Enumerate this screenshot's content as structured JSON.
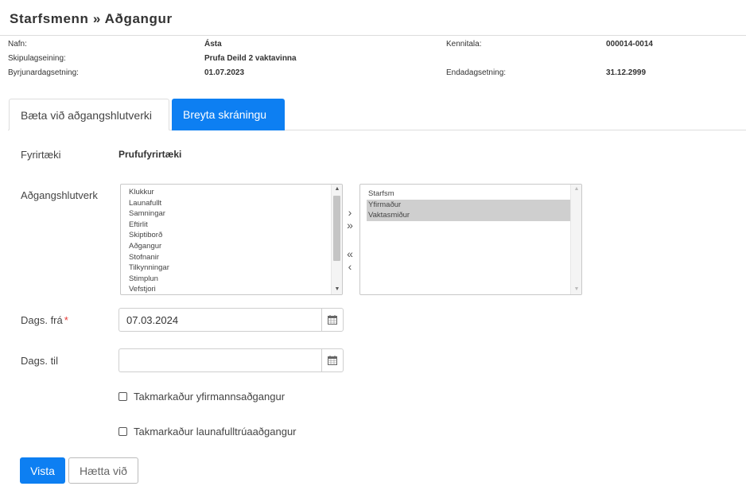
{
  "page": {
    "title": "Starfsmenn » Aðgangur"
  },
  "info": {
    "name_label": "Nafn:",
    "name_value": "Ásta",
    "unit_label": "Skipulagseining:",
    "unit_value": "Prufa Deild 2 vaktavinna",
    "start_label": "Byrjunardagsetning:",
    "start_value": "01.07.2023",
    "ssn_label": "Kennitala:",
    "ssn_value": "000014-0014",
    "end_label": "Endadagsetning:",
    "end_value": "31.12.2999"
  },
  "tabs": [
    {
      "label": "Bæta við aðgangshlutverki",
      "active": false
    },
    {
      "label": "Breyta skráningu",
      "active": true
    }
  ],
  "form": {
    "company_label": "Fyrirtæki",
    "company_value": "Prufufyrirtæki",
    "roles_label": "Aðgangshlutverk",
    "available_roles": [
      "Klukkur",
      "Launafullt",
      "Samningar",
      "Eftirlit",
      "Skiptiborð",
      "Aðgangur",
      "Stofnanir",
      "Tilkynningar",
      "Stimplun",
      "Vefstjori"
    ],
    "selected_roles": [
      {
        "label": "Starfsm",
        "highlighted": false
      },
      {
        "label": "Yfirmaður",
        "highlighted": true
      },
      {
        "label": "Vaktasmiður",
        "highlighted": true
      }
    ],
    "move_right": "›",
    "move_all_right": "»",
    "move_all_left": "«",
    "move_left": "‹",
    "date_from_label": "Dags. frá",
    "required_mark": "*",
    "date_from_value": "07.03.2024",
    "date_to_label": "Dags. til",
    "date_to_value": "",
    "checkbox_supervisor": "Takmarkaður yfirmannsaðgangur",
    "checkbox_payroll": "Takmarkaður launafulltrúaaðgangur"
  },
  "actions": {
    "save_label": "Vista",
    "cancel_label": "Hætta við"
  },
  "colors": {
    "primary": "#0d7ff2",
    "required": "#e53935",
    "selected_row": "#cfcfcf"
  },
  "icons": {
    "calendar": "calendar-icon",
    "scroll_up": "caret-up-icon",
    "scroll_down": "caret-down-icon"
  }
}
